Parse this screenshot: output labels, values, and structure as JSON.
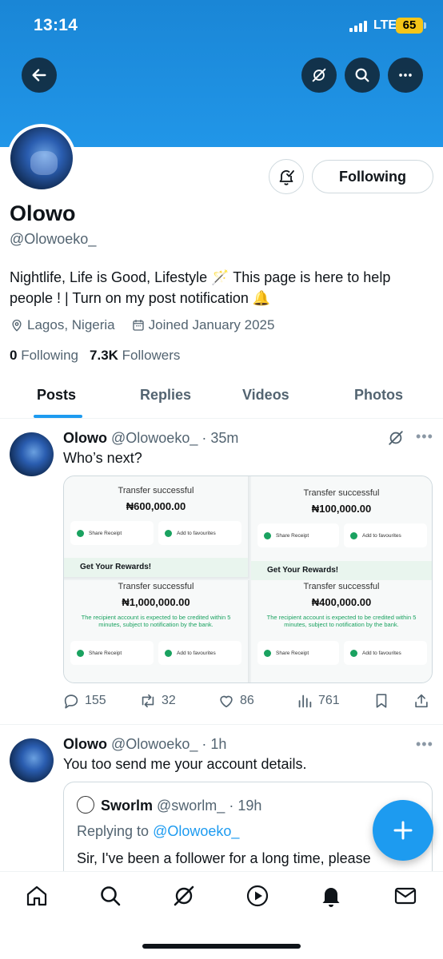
{
  "status_bar": {
    "time": "13:14",
    "network": "LTE",
    "battery": "65"
  },
  "header": {
    "back_icon": "arrow-left-icon",
    "grok_icon": "grok-icon",
    "search_icon": "search-icon",
    "more_icon": "more-icon"
  },
  "profile": {
    "display_name": "Olowo",
    "handle": "@Olowoeko_",
    "bio_line1": "Nightlife, Life is Good, Lifestyle 🪄 This page is here to help",
    "bio_line2": "people ! | Turn on my post notification 🔔",
    "location": "Lagos, Nigeria",
    "joined": "Joined January 2025",
    "following_count": "0",
    "following_label": "Following",
    "followers_count": "7.3K",
    "followers_label": "Followers",
    "follow_button": "Following"
  },
  "tabs": [
    {
      "label": "Posts",
      "active": true
    },
    {
      "label": "Replies",
      "active": false
    },
    {
      "label": "Videos",
      "active": false
    },
    {
      "label": "Photos",
      "active": false
    }
  ],
  "posts": [
    {
      "name": "Olowo",
      "handle": "@Olowoeko_",
      "time": "· 35m",
      "text": "Who’s next?",
      "media": [
        {
          "title": "Transfer successful",
          "amount": "₦600,000.00",
          "chip1": "Share Receipt",
          "chip2": "Add to favourites",
          "rewards": "Get Your Rewards!"
        },
        {
          "title": "Transfer successful",
          "amount": "₦100,000.00",
          "chip1": "Share Receipt",
          "chip2": "Add to favourites",
          "rewards": "Get Your Rewards!"
        },
        {
          "title": "Transfer successful",
          "amount": "₦1,000,000.00",
          "note": "The recipient account is expected to be credited within 5 minutes, subject to notification by the bank.",
          "chip1": "Share Receipt",
          "chip2": "Add to favourites"
        },
        {
          "title": "Transfer successful",
          "amount": "₦400,000.00",
          "note": "The recipient account is expected to be credited within 5 minutes, subject to notification by the bank.",
          "chip1": "Share Receipt",
          "chip2": "Add to favourites"
        }
      ],
      "replies": "155",
      "reposts": "32",
      "likes": "86",
      "views": "761"
    },
    {
      "name": "Olowo",
      "handle": "@Olowoeko_",
      "time": "· 1h",
      "text": "You too send me your account details.",
      "quote": {
        "name": "Sworlm",
        "handle": "@sworlm_",
        "time": "· 19h",
        "replying_prefix": "Replying to",
        "replying_to": "@Olowoeko_",
        "text": "Sir, I've been a follower for a long time, please"
      }
    }
  ],
  "fab_icon": "plus-icon",
  "bottom_nav": [
    "home-icon",
    "search-icon",
    "grok-icon",
    "play-icon",
    "bell-icon",
    "mail-icon"
  ],
  "colors": {
    "accent": "#1d9bf0",
    "banner": "#2196e8",
    "text": "#0f1419",
    "muted": "#536471"
  }
}
